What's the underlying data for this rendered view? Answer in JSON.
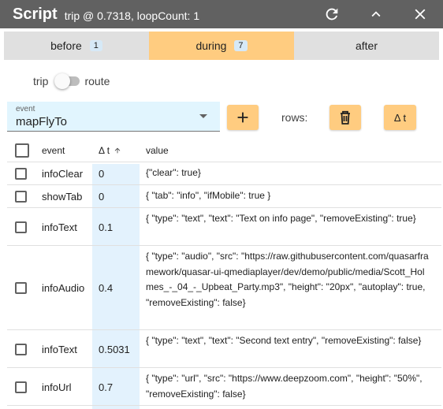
{
  "header": {
    "title": "Script",
    "subtitle": "trip @ 0.7318, loopCount: 1",
    "icons": [
      "refresh-icon",
      "chevron-up-icon",
      "close-icon"
    ]
  },
  "tabs": [
    {
      "label": "before",
      "count": "1",
      "active": false
    },
    {
      "label": "during",
      "count": "7",
      "active": true
    },
    {
      "label": "after",
      "count": "",
      "active": false
    }
  ],
  "toggle": {
    "left_label": "trip",
    "right_label": "route",
    "on": false
  },
  "event_select": {
    "label": "event",
    "value": "mapFlyTo"
  },
  "toolbar": {
    "rows_label": "rows:",
    "dt_label": "Δ t"
  },
  "table": {
    "headers": {
      "event": "event",
      "dt": "Δ t",
      "value": "value"
    },
    "rows": [
      {
        "event": "infoClear",
        "dt": "0",
        "value": "{\"clear\": true}"
      },
      {
        "event": "showTab",
        "dt": "0",
        "value": "{ \"tab\": \"info\", \"ifMobile\": true }"
      },
      {
        "event": "infoText",
        "dt": "0.1",
        "value": "{ \"type\": \"text\", \"text\": \"Text on info page\", \"removeExisting\": true}"
      },
      {
        "event": "infoAudio",
        "dt": "0.4",
        "value": "{ \"type\": \"audio\", \"src\": \"https://raw.githubusercontent.com/quasarframework/quasar-ui-qmediaplayer/dev/demo/public/media/Scott_Holmes_-_04_-_Upbeat_Party.mp3\", \"height\": \"20px\", \"autoplay\": true, \"removeExisting\": false}"
      },
      {
        "event": "infoText",
        "dt": "0.5031",
        "value": "{ \"type\": \"text\", \"text\": \"Second text entry\", \"removeExisting\": false}"
      },
      {
        "event": "infoUrl",
        "dt": "0.7",
        "value": "{ \"type\": \"url\", \"src\": \"https://www.deepzoom.com\", \"height\": \"50%\", \"removeExisting\": false}"
      }
    ]
  },
  "colors": {
    "titlebar": "#616161",
    "accent": "#ffcc80",
    "dt_column": "#e3f2fd"
  }
}
